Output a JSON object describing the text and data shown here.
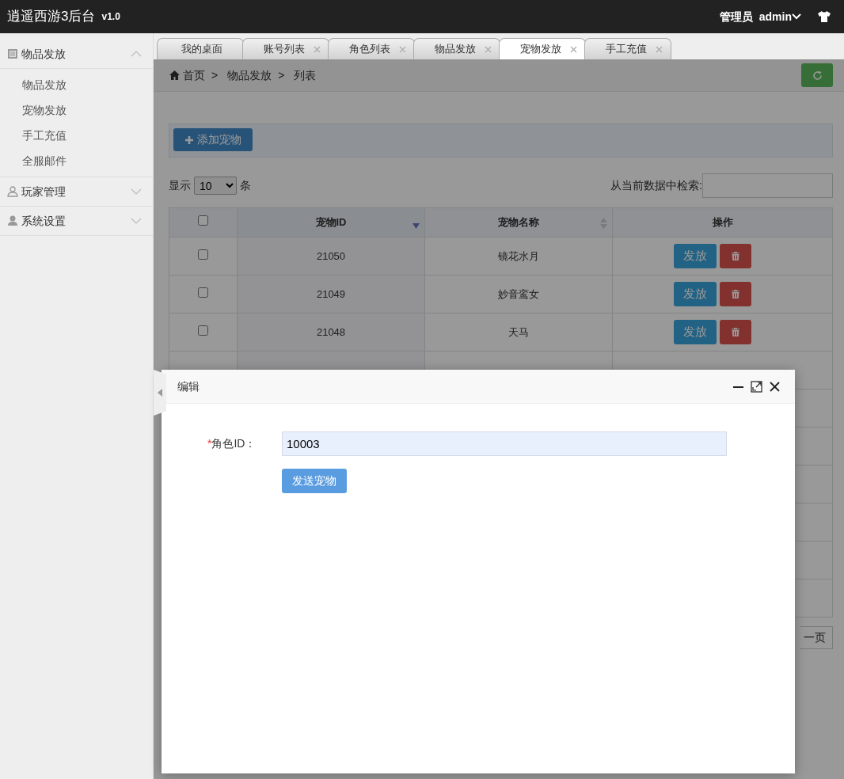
{
  "app": {
    "title": "逍遥西游3后台",
    "version": "v1.0"
  },
  "user": {
    "role": "管理员",
    "name": "admin"
  },
  "sidebar": [
    {
      "label": "物品发放",
      "expanded": true,
      "children": [
        {
          "label": "物品发放"
        },
        {
          "label": "宠物发放"
        },
        {
          "label": "手工充值"
        },
        {
          "label": "全服邮件"
        }
      ]
    },
    {
      "label": "玩家管理",
      "expanded": false
    },
    {
      "label": "系统设置",
      "expanded": false
    }
  ],
  "tabs": [
    {
      "label": "我的桌面",
      "selected": false,
      "closable": false
    },
    {
      "label": "账号列表",
      "selected": false,
      "closable": true
    },
    {
      "label": "角色列表",
      "selected": false,
      "closable": true
    },
    {
      "label": "物品发放",
      "selected": false,
      "closable": true
    },
    {
      "label": "宠物发放",
      "selected": true,
      "closable": true
    },
    {
      "label": "手工充值",
      "selected": false,
      "closable": true
    }
  ],
  "breadcrumb": [
    "首页",
    "物品发放",
    "列表"
  ],
  "breadcrumb_separator": ">",
  "add_button": "添加宠物",
  "page_length": {
    "label_before": "显示",
    "value": "10",
    "label_after": "条"
  },
  "search": {
    "label": "从当前数据中检索:"
  },
  "table": {
    "select_all": {
      "checked": false
    },
    "columns": [
      {
        "label": "宠物ID",
        "sortable": true,
        "sorted": true
      },
      {
        "label": "宠物名称",
        "sortable": true,
        "sorted": false
      },
      {
        "label": "操作",
        "sortable": false
      }
    ],
    "rows": [
      {
        "checked": false,
        "id": "21050",
        "name": "镜花水月",
        "action": "发放"
      },
      {
        "checked": false,
        "id": "21049",
        "name": "妙音鸾女",
        "action": "发放"
      },
      {
        "checked": false,
        "id": "21048",
        "name": "天马",
        "action": "发放"
      }
    ]
  },
  "pager": {
    "next": "一页"
  },
  "dialog": {
    "title": "编辑",
    "field": {
      "required_mark": "*",
      "label": "角色ID：",
      "value": "10003"
    },
    "submit": "发送宠物"
  }
}
